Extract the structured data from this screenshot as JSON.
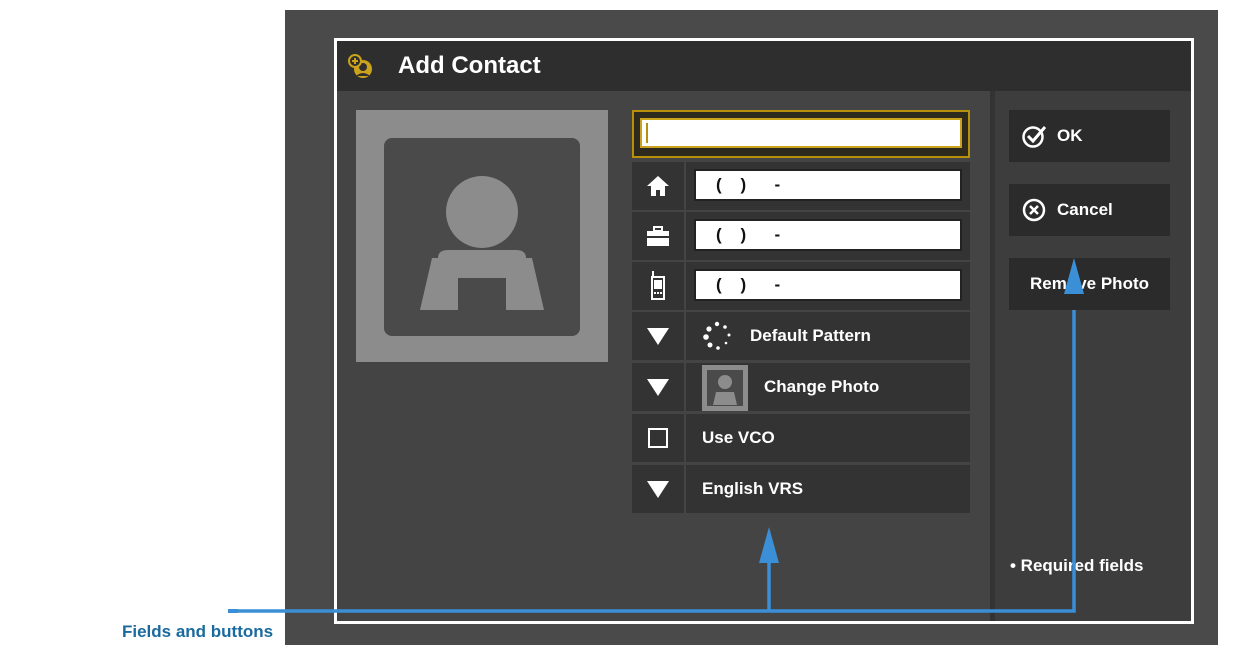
{
  "dialog": {
    "title": "Add Contact"
  },
  "form": {
    "name_value": "",
    "phones": [
      {
        "type": "home-icon",
        "value": "(    )      -"
      },
      {
        "type": "work-icon",
        "value": "(    )      -"
      },
      {
        "type": "mobile-icon",
        "value": "(    )      -"
      }
    ],
    "ring_pattern_label": "Default Pattern",
    "change_photo_label": "Change Photo",
    "vco_label": "Use VCO",
    "language_label": "English VRS"
  },
  "buttons": {
    "ok_label": "OK",
    "cancel_label": "Cancel",
    "remove_photo_label": "Remove Photo"
  },
  "footer": {
    "required_note": "• Required fields"
  },
  "annotation": {
    "label": "Fields and buttons",
    "color": "#3a8fd6"
  },
  "colors": {
    "accent": "#caa21b",
    "panel": "#444444",
    "button": "#2b2b2b"
  }
}
